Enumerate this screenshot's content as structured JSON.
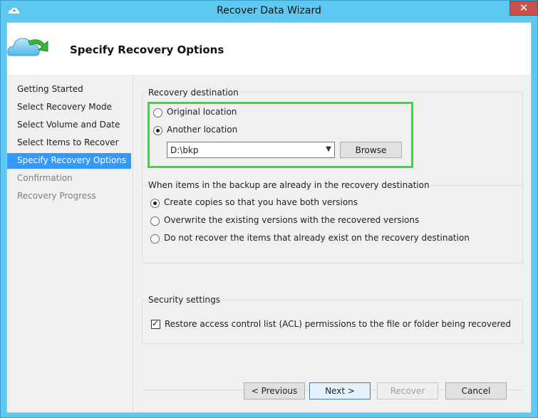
{
  "window": {
    "title": "Recover Data Wizard",
    "close_glyph": "✕"
  },
  "header": {
    "title": "Specify Recovery Options",
    "icon": "cloud-recovery-icon"
  },
  "steps": [
    {
      "label": "Getting Started",
      "state": "done"
    },
    {
      "label": "Select Recovery Mode",
      "state": "done"
    },
    {
      "label": "Select Volume and Date",
      "state": "done"
    },
    {
      "label": "Select Items to Recover",
      "state": "done"
    },
    {
      "label": "Specify Recovery Options",
      "state": "active"
    },
    {
      "label": "Confirmation",
      "state": "disabled"
    },
    {
      "label": "Recovery Progress",
      "state": "disabled"
    }
  ],
  "destination": {
    "label": "Recovery destination",
    "original_label": "Original location",
    "another_label": "Another location",
    "selected": "another",
    "path_value": "D:\\bkp",
    "browse_label": "Browse"
  },
  "conflict": {
    "label": "When items in the backup are already in the recovery destination",
    "options": [
      "Create copies so that you have both versions",
      "Overwrite the existing versions with the recovered versions",
      "Do not recover the items that already exist on the recovery destination"
    ],
    "selected_index": 0
  },
  "security": {
    "label": "Security settings",
    "acl_label": "Restore access control list (ACL) permissions to the file or folder being recovered",
    "acl_checked": true
  },
  "footer": {
    "previous": "< Previous",
    "next": "Next >",
    "recover": "Recover",
    "cancel": "Cancel"
  },
  "colors": {
    "titlebar": "#5ec8f0",
    "active_step": "#3399ff",
    "highlight": "#2fe12f",
    "close": "#c7514b"
  }
}
